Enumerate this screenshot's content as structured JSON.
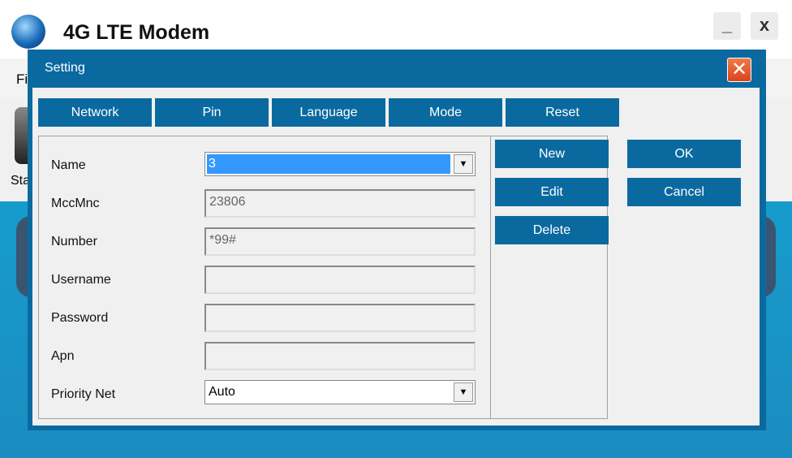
{
  "app": {
    "title": "4G LTE Modem",
    "menu_partial": "Fi",
    "toolbar_partial": "Sta",
    "minimize": "_",
    "close": "x"
  },
  "dialog": {
    "title": "Setting",
    "close": "✕",
    "tabs": [
      "Network",
      "Pin",
      "Language",
      "Mode",
      "Reset"
    ],
    "fields": {
      "name_label": "Name",
      "name_value": "3",
      "mccmnc_label": "MccMnc",
      "mccmnc_value": "23806",
      "number_label": "Number",
      "number_value": "*99#",
      "username_label": "Username",
      "username_value": "",
      "password_label": "Password",
      "password_value": "",
      "apn_label": "Apn",
      "apn_value": "",
      "priority_label": "Priority Net",
      "priority_value": "Auto"
    },
    "buttons": {
      "new": "New",
      "edit": "Edit",
      "delete": "Delete",
      "ok": "OK",
      "cancel": "Cancel"
    }
  }
}
